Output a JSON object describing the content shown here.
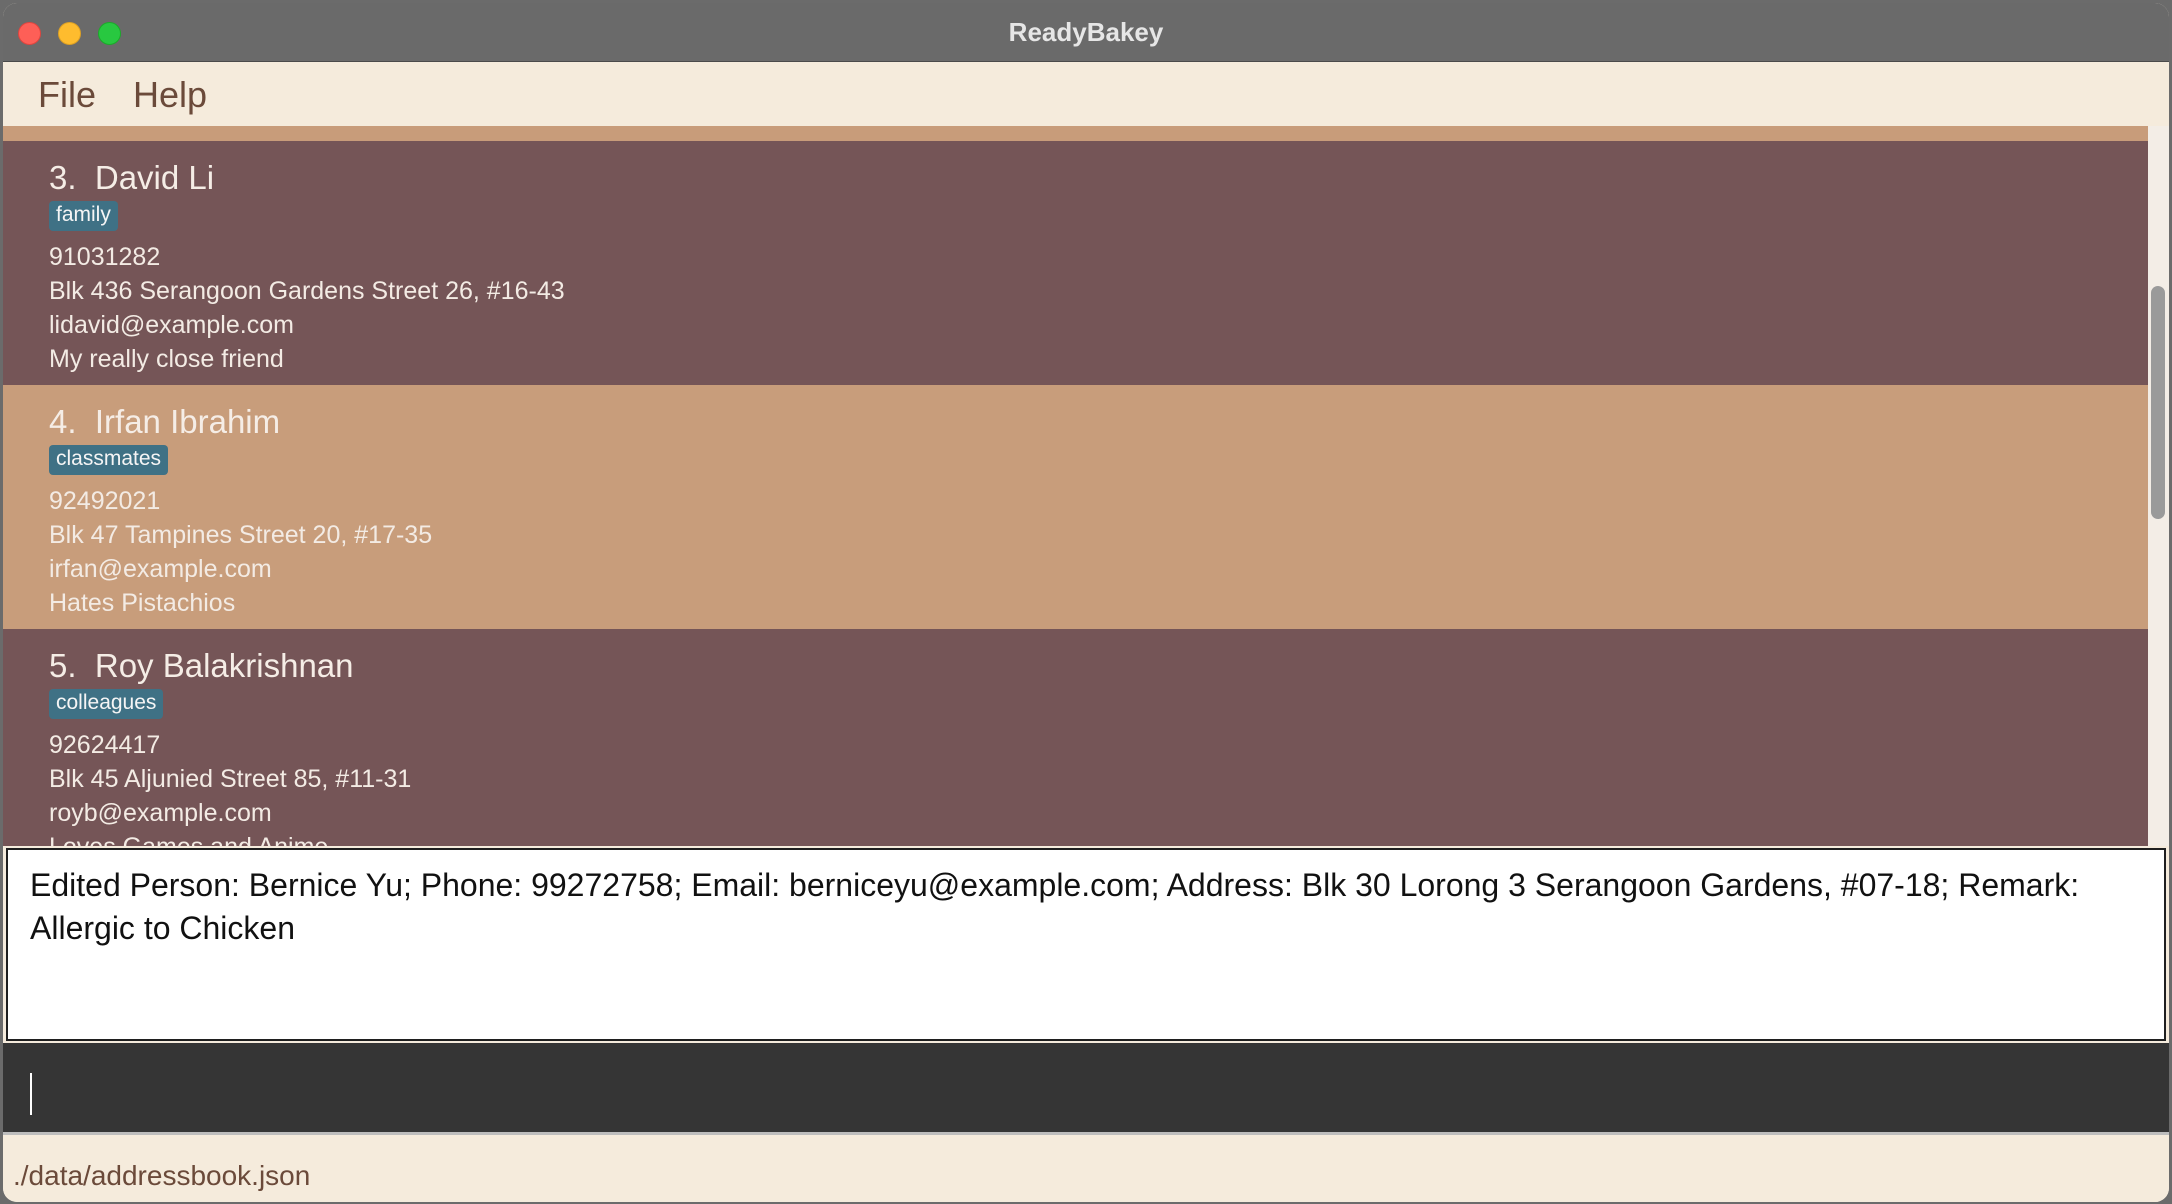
{
  "window": {
    "title": "ReadyBakey"
  },
  "menu": {
    "file": "File",
    "help": "Help"
  },
  "persons": [
    {
      "index": "3.",
      "name": "David Li",
      "tag": "family",
      "phone": "91031282",
      "address": "Blk 436 Serangoon Gardens Street 26, #16-43",
      "email": "lidavid@example.com",
      "remark": "My really close friend"
    },
    {
      "index": "4.",
      "name": "Irfan Ibrahim",
      "tag": "classmates",
      "phone": "92492021",
      "address": "Blk 47 Tampines Street 20, #17-35",
      "email": "irfan@example.com",
      "remark": "Hates Pistachios"
    },
    {
      "index": "5.",
      "name": "Roy Balakrishnan",
      "tag": "colleagues",
      "phone": "92624417",
      "address": "Blk 45 Aljunied Street 85, #11-31",
      "email": "royb@example.com",
      "remark": "Loves Games and Anime"
    }
  ],
  "result": {
    "text": "Edited Person: Bernice Yu; Phone: 99272758; Email: berniceyu@example.com; Address: Blk 30 Lorong 3 Serangoon Gardens, #07-18; Remark: Allergic to Chicken"
  },
  "command": {
    "value": ""
  },
  "status": {
    "path": "./data/addressbook.json"
  },
  "colors": {
    "card_dark": "#755557",
    "card_light": "#c89d7b",
    "tag_bg": "#3f7185",
    "background": "#f5ebdc"
  }
}
